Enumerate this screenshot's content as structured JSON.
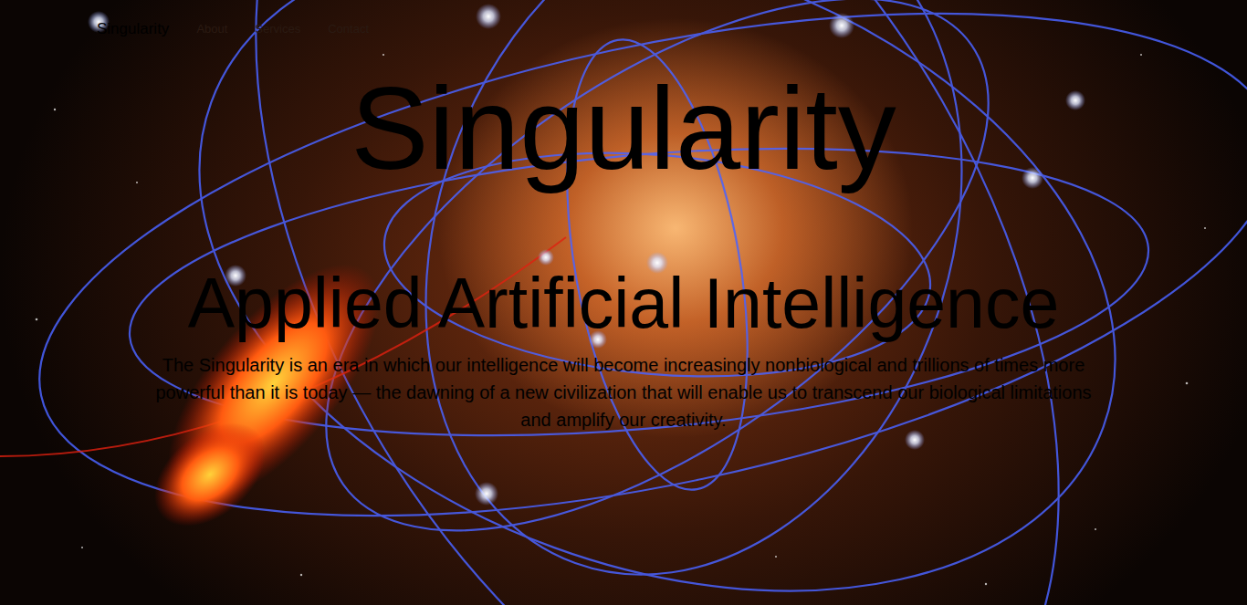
{
  "navbar": {
    "brand": "Singularity",
    "links": [
      {
        "label": "About"
      },
      {
        "label": "Services"
      },
      {
        "label": "Contact"
      }
    ]
  },
  "hero": {
    "title": "Singularity",
    "subtitle": "Applied Artificial Intelligence",
    "text": "The Singularity is an era in which our intelligence will become increasingly nonbiological and trillions of times more powerful than it is today — the dawning of a new civilization that will enable us to transcend our biological limitations and amplify our creativity."
  }
}
